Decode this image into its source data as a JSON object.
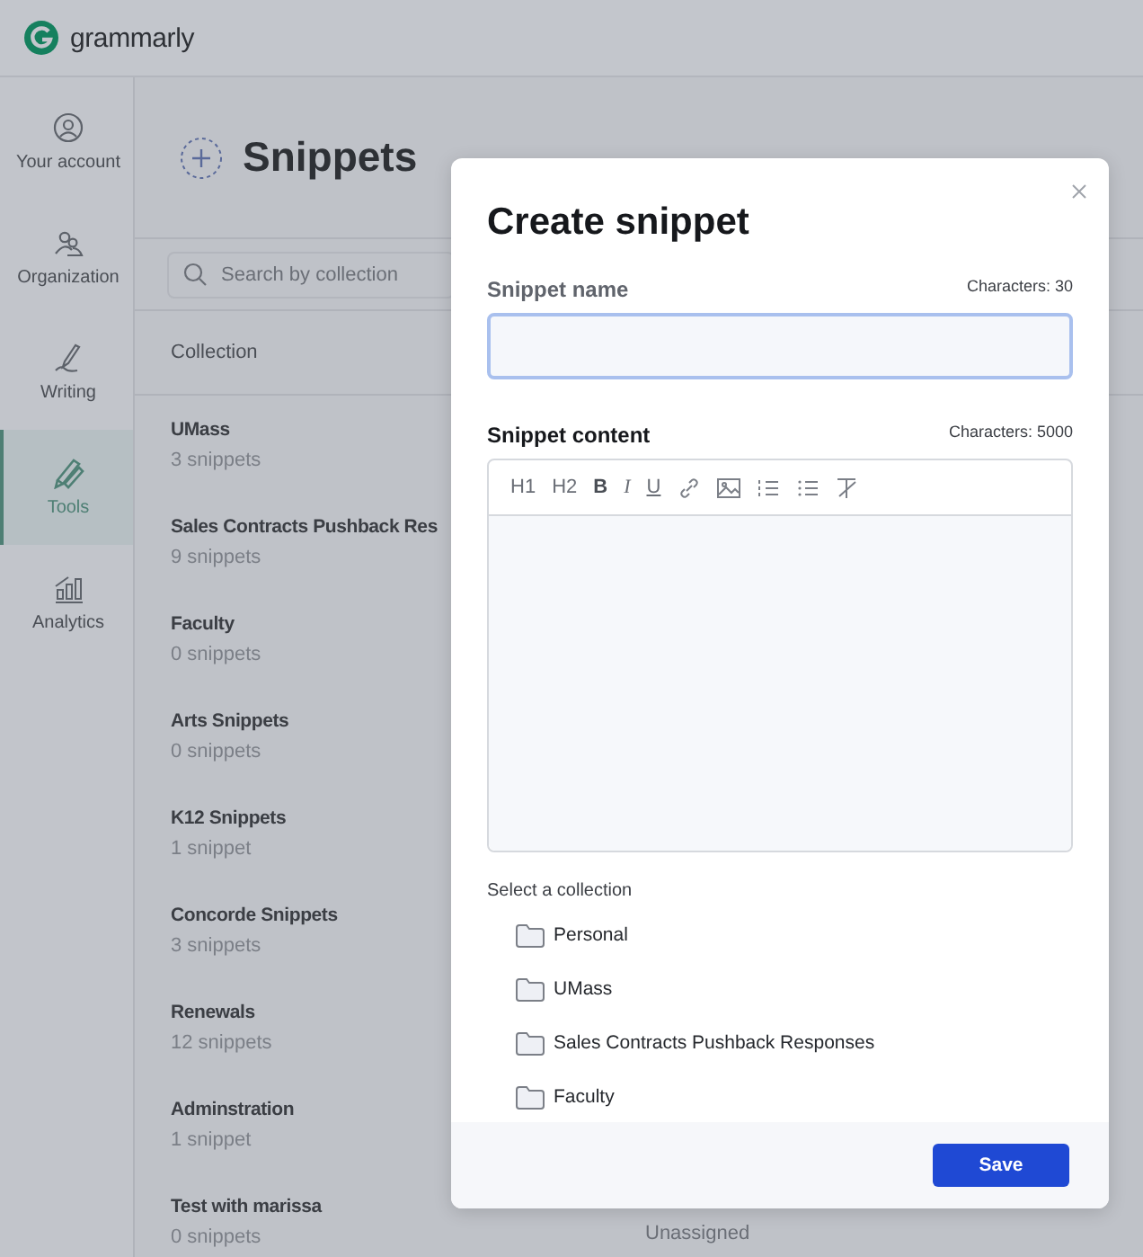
{
  "header": {
    "logo_text": "grammarly"
  },
  "sidebar": {
    "items": [
      {
        "label": "Your account",
        "selected": false
      },
      {
        "label": "Organization",
        "selected": false
      },
      {
        "label": "Writing",
        "selected": false
      },
      {
        "label": "Tools",
        "selected": true
      },
      {
        "label": "Analytics",
        "selected": false
      }
    ]
  },
  "page": {
    "title": "Snippets",
    "search": {
      "placeholder": "Search by collection"
    },
    "table": {
      "columns": [
        "Collection"
      ],
      "rows": [
        {
          "name": "UMass",
          "count": "3 snippets"
        },
        {
          "name": "Sales Contracts Pushback Res",
          "count": "9 snippets"
        },
        {
          "name": "Faculty",
          "count": "0 snippets"
        },
        {
          "name": "Arts Snippets",
          "count": "0 snippets"
        },
        {
          "name": "K12 Snippets",
          "count": "1 snippet"
        },
        {
          "name": "Concorde Snippets",
          "count": "3 snippets"
        },
        {
          "name": "Renewals",
          "count": "12 snippets"
        },
        {
          "name": "Adminstration",
          "count": "1 snippet"
        },
        {
          "name": "Test with marissa",
          "count": "0 snippets",
          "column_2": "Unassigned"
        }
      ]
    }
  },
  "modal": {
    "title": "Create snippet",
    "name_field": {
      "label": "Snippet name",
      "limit": "Characters: 30"
    },
    "content_field": {
      "label": "Snippet content",
      "limit": "Characters: 5000",
      "toolbar_labels": [
        "H1",
        "H2",
        "B",
        "I",
        "U"
      ]
    },
    "collection_picker": {
      "label": "Select a collection",
      "options": [
        "Personal",
        "UMass",
        "Sales Contracts Pushback Responses",
        "Faculty"
      ]
    },
    "save_button": "Save"
  }
}
